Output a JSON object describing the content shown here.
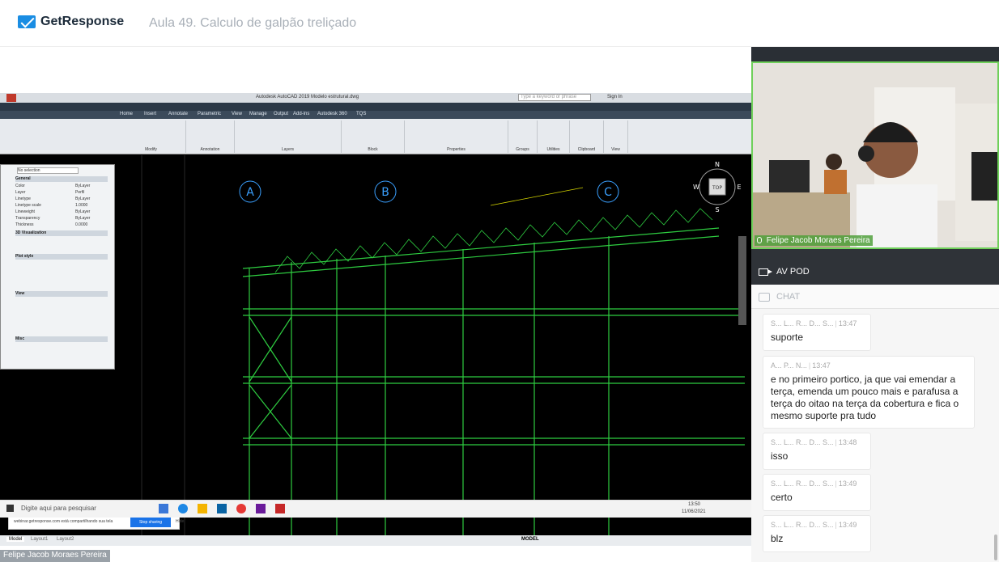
{
  "header": {
    "brand": "GetResponse",
    "lesson_title": "Aula 49. Calculo de galpão treliçado"
  },
  "shared_screen": {
    "app_title": "Autodesk AutoCAD 2019   Modelo estrutural.dwg",
    "search_placeholder": "Type a keyword or phrase",
    "sign_in": "Sign In",
    "ribbon_tabs": [
      "Home",
      "Insert",
      "Annotate",
      "Parametric",
      "View",
      "Manage",
      "Output",
      "Add-ins",
      "Autodesk 360",
      "TQS"
    ],
    "ribbon_groups": [
      "Modify",
      "Annotation",
      "Layers",
      "Block",
      "Properties",
      "Groups",
      "Utilities",
      "Clipboard",
      "View"
    ],
    "properties_panel": {
      "selection": "No selection",
      "sections": [
        "General",
        "3D Visualization",
        "Plot style",
        "View",
        "Misc"
      ],
      "rows": [
        {
          "label": "Color",
          "value": "ByLayer"
        },
        {
          "label": "Layer",
          "value": "Perfil"
        },
        {
          "label": "Linetype",
          "value": "ByLayer"
        },
        {
          "label": "Linetype scale",
          "value": "1.0000"
        },
        {
          "label": "Lineweight",
          "value": "ByLayer"
        },
        {
          "label": "Transparency",
          "value": "ByLayer"
        },
        {
          "label": "Thickness",
          "value": "0.0000"
        }
      ]
    },
    "axis_labels": [
      "A",
      "B",
      "C"
    ],
    "compass": {
      "n": "N",
      "s": "S",
      "e": "E",
      "w": "W",
      "top": "TOP"
    },
    "sharing_text": "webinar.getresponse.com está compartilhando sua tela",
    "stop_sharing": "Stop sharing",
    "hide": "Hide",
    "model_tabs": [
      "Model",
      "Layout1",
      "Layout2"
    ],
    "status_model": "MODEL",
    "taskbar_search": "Digite aqui para pesquisar",
    "clock_time": "13:50",
    "clock_date": "11/06/2021"
  },
  "presenter_tag": "Felipe Jacob Moraes Pereira",
  "side_panel": {
    "video_name": "Felipe Jacob Moraes Pereira",
    "av_title": "AV POD",
    "chat_title": "CHAT",
    "messages": [
      {
        "sender": "S... L... R... D... S...",
        "time": "13:47",
        "text": "suporte"
      },
      {
        "sender": "A... P... N...",
        "time": "13:47",
        "text": "e no primeiro portico, ja que vai emendar a terça, emenda um pouco mais e parafusa a terça do oitao na terça da cobertura e fica o mesmo suporte pra tudo"
      },
      {
        "sender": "S... L... R... D... S...",
        "time": "13:48",
        "text": "isso"
      },
      {
        "sender": "S... L... R... D... S...",
        "time": "13:49",
        "text": "certo"
      },
      {
        "sender": "S... L... R... D... S...",
        "time": "13:49",
        "text": "blz"
      }
    ]
  }
}
